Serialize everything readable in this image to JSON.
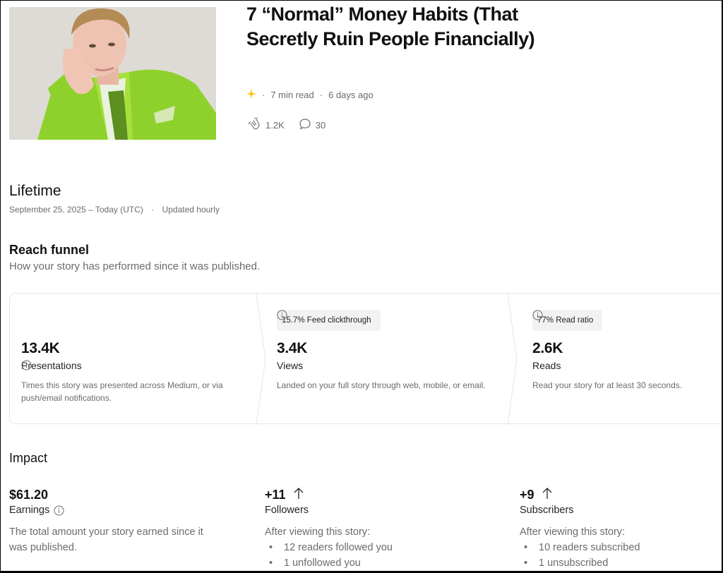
{
  "story": {
    "title": "7 “Normal” Money Habits (That Secretly Ruin People Financially)",
    "read_time": "7 min read",
    "published_ago": "6 days ago",
    "claps": "1.2K",
    "responses": "30",
    "member_icon": "sparkle-icon",
    "accent_color": "#ffc017"
  },
  "lifetime": {
    "heading": "Lifetime",
    "date_range": "September 25, 2025 – Today (UTC)",
    "update_note": "Updated hourly"
  },
  "funnel": {
    "heading": "Reach funnel",
    "description": "How your story has performed since it was published.",
    "stages": [
      {
        "chip": "",
        "value": "13.4K",
        "label": "Presentations",
        "description": "Times this story was presented across Medium, or via push/email notifications."
      },
      {
        "chip": "15.7% Feed clickthrough",
        "value": "3.4K",
        "label": "Views",
        "description": "Landed on your full story through web, mobile, or email."
      },
      {
        "chip": "77% Read ratio",
        "value": "2.6K",
        "label": "Reads",
        "description": "Read your story for at least 30 seconds."
      }
    ]
  },
  "impact": {
    "heading": "Impact",
    "earnings": {
      "value": "$61.20",
      "label": "Earnings",
      "description": "The total amount your story earned since it was published."
    },
    "followers": {
      "value": "+11",
      "label": "Followers",
      "intro": "After viewing this story:",
      "items": [
        "12 readers followed you",
        "1 unfollowed you"
      ]
    },
    "subscribers": {
      "value": "+9",
      "label": "Subscribers",
      "intro": "After viewing this story:",
      "items": [
        "10 readers subscribed",
        "1 unsubscribed"
      ]
    }
  }
}
